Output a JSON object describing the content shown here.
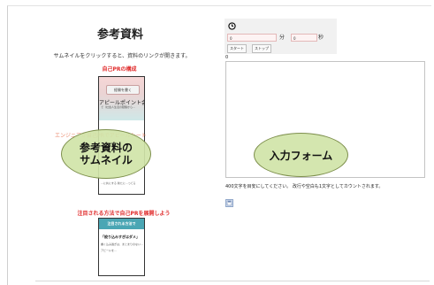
{
  "reference": {
    "title": "参考資料",
    "caption": "サムネイルをクリックすると、資料のリンクが開きます。",
    "sections": [
      {
        "heading": "自己PRの構成",
        "thumbnail": {
          "button_label": "経験を書く",
          "heading": "アピールポイント会",
          "line1": "で（社会人生活の経験から...",
          "line2": "...に共にする 新たに...ってる"
        }
      },
      {
        "heading": "注目される方法で自己PRを展開しよう",
        "thumbnail": {
          "header": "注目される方法で",
          "quote": "「絞り込みすぎはダメ」",
          "line1": "書く込み過ぎは、まとまりのない...",
          "line2": "アピールを..."
        }
      }
    ],
    "ghost_label": "エンジニアが自己PRでアピールシート",
    "annotation": "参考資料の\nサムネイル"
  },
  "timer": {
    "minutes_value": "0",
    "minutes_label": "分",
    "seconds_value": "0",
    "seconds_label": "秒",
    "start_label": "スタート",
    "stop_label": "ストップ",
    "icon": "clock-icon"
  },
  "form": {
    "char_count": "0",
    "annotation": "入力フォーム",
    "notice": "400文字を目安にしてください。 改行や空白も1文字としてカウントされます。",
    "icon": "save-icon"
  }
}
